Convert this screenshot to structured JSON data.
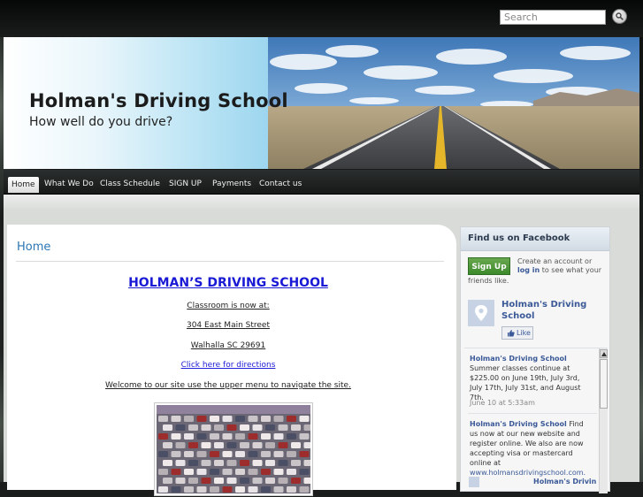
{
  "search": {
    "placeholder": "Search"
  },
  "header": {
    "title": "Holman's Driving School",
    "tagline": "How well do you drive?"
  },
  "nav": {
    "items": [
      {
        "label": "Home",
        "active": true
      },
      {
        "label": "What We Do"
      },
      {
        "label": "Class Schedule"
      },
      {
        "label": "SIGN UP"
      },
      {
        "label": "Payments"
      },
      {
        "label": "Contact us"
      }
    ]
  },
  "main": {
    "heading": "Home",
    "school_title": "HOLMAN’S DRIVING SCHOOL",
    "lines": [
      "Classroom is now at:",
      "304 East Main Street",
      "Walhalla SC 29691",
      "Click here for directions",
      "Welcome to our site use the upper menu to navigate the site."
    ]
  },
  "facebook": {
    "title": "Find us on Facebook",
    "signup": "Sign Up",
    "create_text": "Create an account or",
    "login_link": "log in",
    "create_text_2": "to see what your",
    "friends_text": "friends like.",
    "page_name": "Holman's Driving School",
    "like": "Like",
    "posts": [
      {
        "author": "Holman's Driving School",
        "text": "Summer classes continue at $225.00 on June 19th, July 3rd, July 17th, July 31st, and August 7th.",
        "date": "June 10 at 5:33am"
      },
      {
        "author": "Holman's Driving School",
        "text": "Find us now at our new website and register online. We also are now accepting visa or mastercard online at",
        "url": "www.holmansdrivingschool.com."
      }
    ],
    "next_author": "Holman's Drivin"
  },
  "colors": {
    "accent_blue": "#2b76b3",
    "fb_blue": "#3b5998",
    "fb_green": "#4e9a3a"
  }
}
